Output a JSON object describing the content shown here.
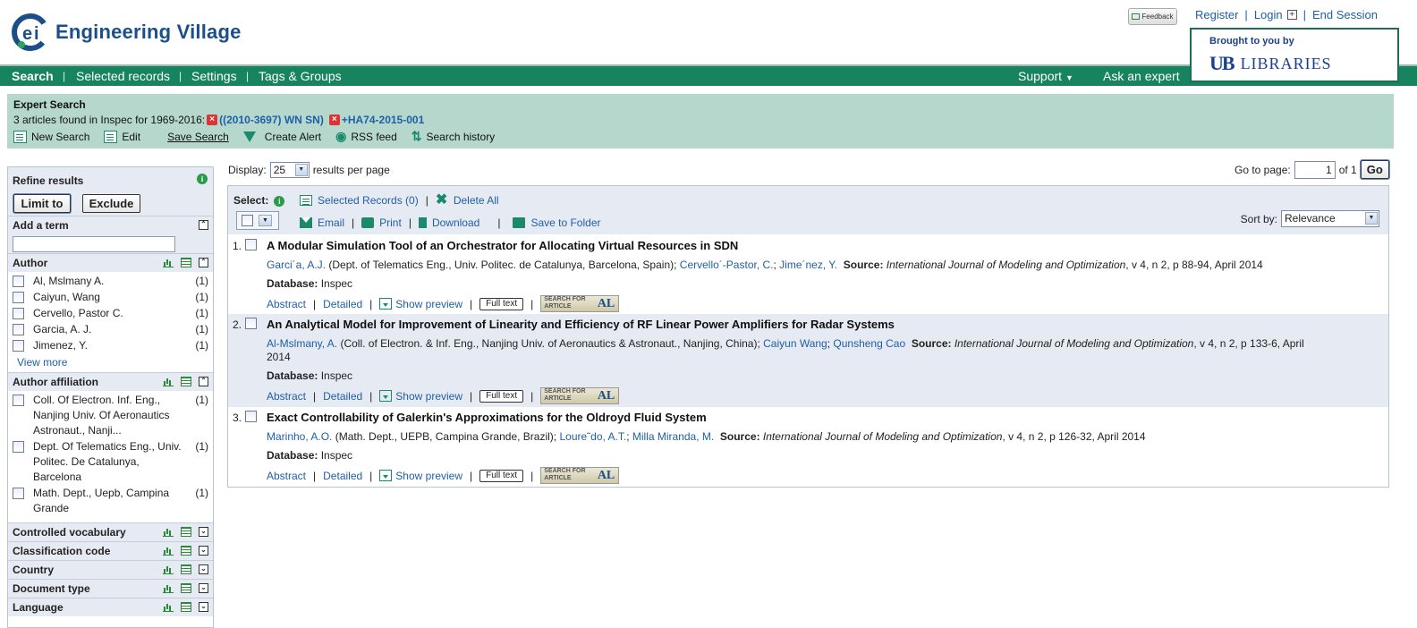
{
  "header": {
    "brand": "Engineering Village",
    "feedback": "Feedback",
    "links": [
      "Register",
      "Login",
      "End Session"
    ],
    "brought_by": "Brought to you by",
    "library_logo": "UB LIBRARIES",
    "library_mark": "UB",
    "library_name": "LIBRARIES"
  },
  "nav": {
    "items": [
      "Search",
      "Selected records",
      "Settings",
      "Tags & Groups"
    ],
    "support": "Support",
    "support_icon": "caret-down-icon",
    "ask": "Ask an expert"
  },
  "expert_search": {
    "title": "Expert Search",
    "found_prefix": "3 articles found in Inspec for 1969-2016:",
    "term1": "((2010-3697) WN SN)",
    "term2": "+HA74-2015-001",
    "actions": [
      "New Search",
      "Edit",
      "Save Search",
      "Create Alert",
      "RSS feed",
      "Search history"
    ]
  },
  "refine": {
    "title": "Refine results",
    "limit_to": "Limit to",
    "exclude": "Exclude",
    "add_term_label": "Add a term",
    "add_term_value": "",
    "author": {
      "label": "Author",
      "items": [
        {
          "name": "Al, Mslmany A.",
          "count": "(1)"
        },
        {
          "name": "Caiyun, Wang",
          "count": "(1)"
        },
        {
          "name": "Cervello, Pastor C.",
          "count": "(1)"
        },
        {
          "name": "Garcia, A. J.",
          "count": "(1)"
        },
        {
          "name": "Jimenez, Y.",
          "count": "(1)"
        }
      ],
      "view_more": "View more"
    },
    "affiliation": {
      "label": "Author affiliation",
      "items": [
        {
          "name": "Coll. Of Electron. Inf. Eng., Nanjing Univ. Of Aeronautics Astronaut., Nanji...",
          "count": "(1)"
        },
        {
          "name": "Dept. Of Telematics Eng., Univ. Politec. De Catalunya, Barcelona",
          "count": "(1)"
        },
        {
          "name": "Math. Dept., Uepb, Campina Grande",
          "count": "(1)"
        }
      ]
    },
    "collapsed_sections": [
      "Controlled vocabulary",
      "Classification code",
      "Country",
      "Document type",
      "Language"
    ]
  },
  "results": {
    "display_label": "Display:",
    "per_page": "25",
    "per_page_suffix": "results per page",
    "goto_label": "Go to page:",
    "page": "1",
    "of_pages": "of 1",
    "go": "Go",
    "select_label": "Select:",
    "selected_records": "Selected Records (0)",
    "delete_all": "Delete All",
    "email": "Email",
    "print": "Print",
    "download": "Download",
    "save_to_folder": "Save to Folder",
    "sort_label": "Sort by:",
    "sort_value": "Relevance",
    "records": [
      {
        "num": "1.",
        "title": "A Modular Simulation Tool of an Orchestrator for Allocating Virtual Resources in SDN",
        "authors1": "Garci´a, A.J.",
        "aff1": " (Dept. of Telematics Eng., Univ. Politec. de Catalunya, Barcelona, Spain); ",
        "authors2": "Cervello´-Pastor, C.",
        "sep2": "; ",
        "authors3": "Jime´nez, Y.",
        "source_label": "Source:",
        "journal": "International Journal of Modeling and Optimization",
        "details": ", v 4, n 2, p 88-94, April 2014",
        "db_label": "Database:",
        "db": "Inspec"
      },
      {
        "num": "2.",
        "title": "An Analytical Model for Improvement of Linearity and Efficiency of RF Linear Power Amplifiers for Radar Systems",
        "authors1": "Al-Mslmany, A.",
        "aff1": " (Coll. of Electron. & Inf. Eng., Nanjing Univ. of Aeronautics & Astronaut., Nanjing, China); ",
        "authors2": "Caiyun Wang",
        "sep2": "; ",
        "authors3": "Qunsheng Cao",
        "source_label": "Source:",
        "journal": "International Journal of Modeling and Optimization",
        "details": ", v 4, n 2, p 133-6, April 2014",
        "db_label": "Database:",
        "db": "Inspec"
      },
      {
        "num": "3.",
        "title": "Exact Controllability of Galerkin's Approximations for the Oldroyd Fluid System",
        "authors1": "Marinho, A.O.",
        "aff1": " (Math. Dept., UEPB, Campina Grande, Brazil); ",
        "authors2": "Loure˜do, A.T.",
        "sep2": "; ",
        "authors3": "Milla Miranda, M.",
        "source_label": "Source:",
        "journal": "International Journal of Modeling and Optimization",
        "details": ", v 4, n 2, p 126-32, April 2014",
        "db_label": "Database:",
        "db": "Inspec"
      }
    ],
    "link_labels": {
      "abstract": "Abstract",
      "detailed": "Detailed",
      "preview": "Show preview",
      "fulltext": "Full text",
      "sfa_line1": "SEARCH FOR",
      "sfa_line2": "ARTICLE",
      "sfa_logo": "AL"
    }
  }
}
